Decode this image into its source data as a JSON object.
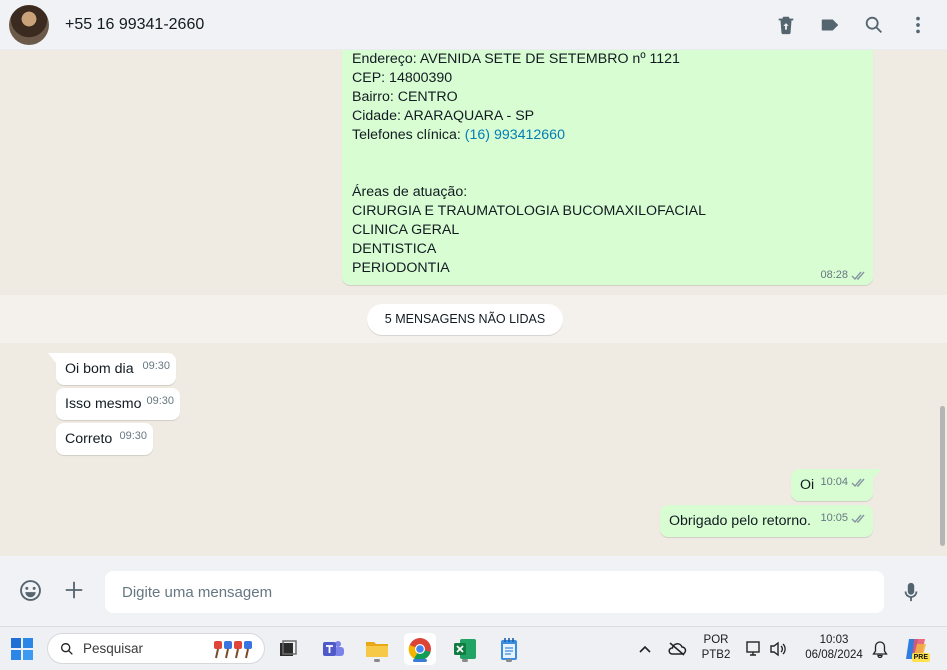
{
  "header": {
    "contact_name": "+55 16 99341-2660",
    "icons": [
      "delete-icon",
      "label-icon",
      "search-icon",
      "menu-icon"
    ]
  },
  "messages": {
    "clinic": {
      "lines": [
        "Endereço: AVENIDA SETE DE SETEMBRO nº 1121",
        "CEP: 14800390",
        "Bairro: CENTRO",
        "Cidade: ARARAQUARA - SP"
      ],
      "phone_label": "Telefones clínica: ",
      "phone_link": "(16) 993412660",
      "areas_title": "Áreas de atuação:",
      "areas": [
        "CIRURGIA E TRAUMATOLOGIA BUCOMAXILOFACIAL",
        "CLINICA GERAL",
        "DENTISTICA",
        "PERIODONTIA"
      ],
      "time": "08:28"
    },
    "unread_label": "5 MENSAGENS NÃO LIDAS",
    "incoming": [
      {
        "text": "Oi bom dia",
        "time": "09:30"
      },
      {
        "text": "Isso mesmo",
        "time": "09:30"
      },
      {
        "text": "Correto",
        "time": "09:30"
      }
    ],
    "outgoing": [
      {
        "text": "Oi",
        "time": "10:04"
      },
      {
        "text": "Obrigado pelo retorno.",
        "time": "10:05"
      }
    ]
  },
  "composer": {
    "placeholder": "Digite uma mensagem"
  },
  "taskbar": {
    "search_label": "Pesquisar",
    "lang_top": "POR",
    "lang_bottom": "PTB2",
    "time": "10:03",
    "date": "06/08/2024",
    "badge": "PRE"
  },
  "colors": {
    "outgoing_bubble": "#d9fdd3",
    "incoming_bubble": "#ffffff",
    "chat_background": "#efeae2",
    "link": "#027eb5"
  }
}
